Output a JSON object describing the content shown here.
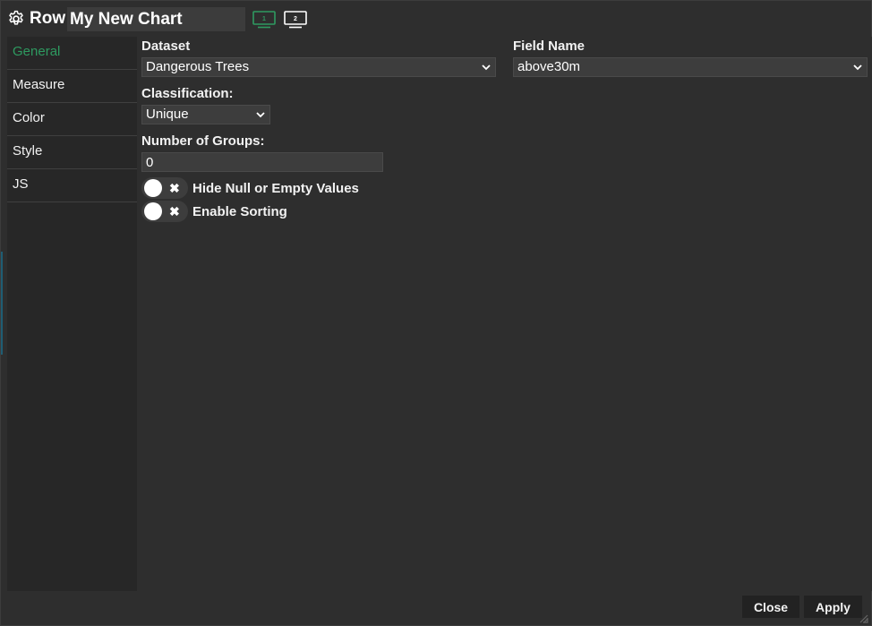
{
  "header": {
    "type_label": "Row",
    "chart_name": "My New Chart",
    "monitor_1_label": "1",
    "monitor_2_label": "2",
    "accent_color": "#2e9a60"
  },
  "sidebar": {
    "items": [
      {
        "label": "General",
        "active": true
      },
      {
        "label": "Measure",
        "active": false
      },
      {
        "label": "Color",
        "active": false
      },
      {
        "label": "Style",
        "active": false
      },
      {
        "label": "JS",
        "active": false
      }
    ]
  },
  "form": {
    "dataset_label": "Dataset",
    "dataset_value": "Dangerous Trees",
    "field_name_label": "Field Name",
    "field_name_value": "above30m",
    "classification_label": "Classification:",
    "classification_value": "Unique",
    "groups_label": "Number of Groups:",
    "groups_value": "0",
    "toggles": [
      {
        "label": "Hide Null or Empty Values",
        "on": false
      },
      {
        "label": "Enable Sorting",
        "on": false
      }
    ]
  },
  "footer": {
    "close_label": "Close",
    "apply_label": "Apply"
  }
}
